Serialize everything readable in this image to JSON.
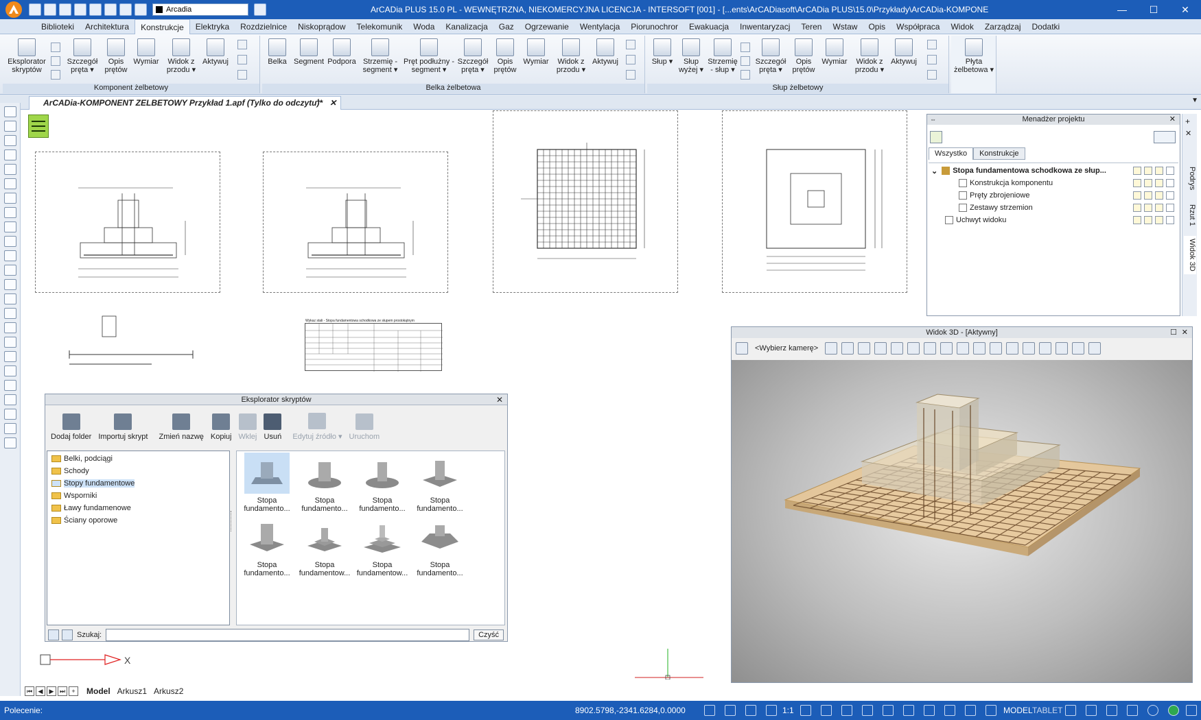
{
  "window": {
    "title": "ArCADia PLUS 15.0 PL - WEWNĘTRZNA, NIEKOMERCYJNA LICENCJA - INTERSOFT [001] - [...ents\\ArCADiasoft\\ArCADia PLUS\\15.0\\Przykłady\\ArCADia-KOMPONENT ZELBETOWY Prz]",
    "layer": "Arcadia",
    "min": "—",
    "max": "☐",
    "close": "✕"
  },
  "menu": [
    "Biblioteki",
    "Architektura",
    "Konstrukcje",
    "Elektryka",
    "Rozdzielnice",
    "Niskoprądow",
    "Telekomunik",
    "Woda",
    "Kanalizacja",
    "Gaz",
    "Ogrzewanie",
    "Wentylacja",
    "Piorunochror",
    "Ewakuacja",
    "Inwentaryzacj",
    "Teren",
    "Wstaw",
    "Opis",
    "Współpraca",
    "Widok",
    "Zarządzaj",
    "Dodatki"
  ],
  "ribbon": {
    "g1": {
      "label": "Komponent żelbetowy",
      "buttons": [
        "Eksplorator skryptów",
        "Szczegół pręta ▾",
        "Opis prętów",
        "Wymiar",
        "Widok z przodu ▾",
        "Aktywuj"
      ]
    },
    "g2": {
      "label": "Belka żelbetowa",
      "buttons": [
        "Belka",
        "Segment",
        "Podpora",
        "Strzemię - segment ▾",
        "Pręt podłużny - segment ▾",
        "Szczegół pręta ▾",
        "Opis prętów",
        "Wymiar",
        "Widok z przodu ▾",
        "Aktywuj"
      ]
    },
    "g3": {
      "label": "Słup żelbetowy",
      "buttons": [
        "Słup ▾",
        "Słup wyżej ▾",
        "Strzemię - słup ▾",
        "Szczegół pręta ▾",
        "Opis prętów",
        "Wymiar",
        "Widok z przodu ▾",
        "Aktywuj"
      ]
    },
    "g4": {
      "buttons": [
        "Płyta żelbetowa ▾"
      ]
    }
  },
  "doc_tab": "ArCADia-KOMPONENT ZELBETOWY Przykład 1.apf (Tylko do odczytu)*",
  "script_explorer": {
    "title": "Eksplorator skryptów",
    "toolbar": [
      "Dodaj folder",
      "Importuj skrypt",
      "Zmień nazwę",
      "Kopiuj",
      "Wklej",
      "Usuń",
      "Edytuj źródło ▾",
      "Uruchom"
    ],
    "folders": [
      "Belki, podciągi",
      "Schody",
      "Stopy fundamentowe",
      "Wsporniki",
      "Ławy fundamenowe",
      "Ściany oporowe"
    ],
    "thumbs": [
      "Stopa fundamento...",
      "Stopa fundamento...",
      "Stopa fundamento...",
      "Stopa fundamento...",
      "Stopa fundamento...",
      "Stopa fundamentow...",
      "Stopa fundamentow...",
      "Stopa fundamento..."
    ],
    "search_label": "Szukaj:",
    "clear": "Czyść"
  },
  "project_manager": {
    "title": "Menadżer projektu",
    "tabs": [
      "Wszystko",
      "Konstrukcje"
    ],
    "items": [
      "Stopa fundamentowa schodkowa ze słup...",
      "Konstrukcja komponentu",
      "Pręty zbrojeniowe",
      "Zestawy strzemion",
      "Uchwyt widoku"
    ]
  },
  "side_tabs": [
    "Podrys",
    "Rzut 1",
    "Widok 3D"
  ],
  "view3d": {
    "title": "Widok 3D - [Aktywny]",
    "camera": "<Wybierz kamerę>"
  },
  "sheets": [
    "Model",
    "Arkusz1",
    "Arkusz2"
  ],
  "status": {
    "prompt": "Polecenie:",
    "coords": "8902.5798,-2341.6284,0.0000",
    "scale": "1:1",
    "mode1": "MODEL",
    "mode2": "TABLET"
  },
  "colors": {
    "title_bar": "#1c5db8",
    "ribbon_bg": "#e1e8f2",
    "concrete_3d": "#d8c7a6",
    "rebar": "#6b4a2b"
  },
  "drawing": {
    "table_title": "Wykaz stali - Stopa fundamentowa schodkowa ze słupem prostokątnym"
  }
}
